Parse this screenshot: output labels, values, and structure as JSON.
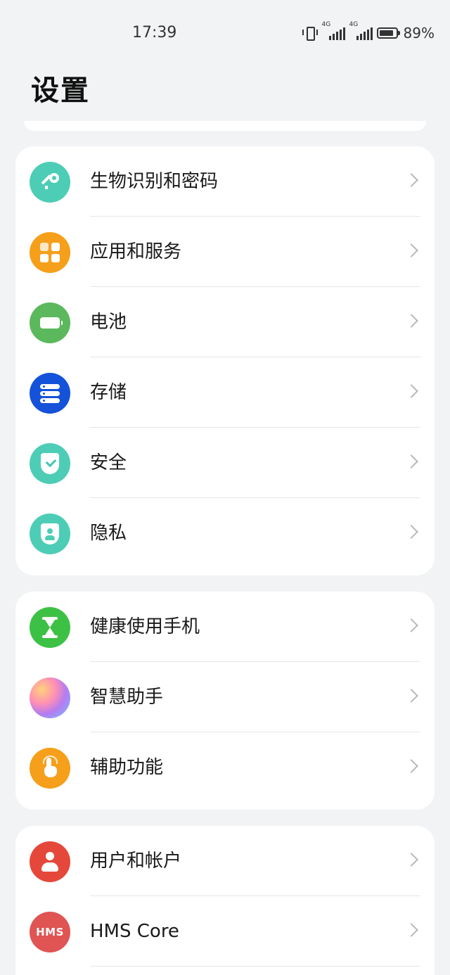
{
  "status_bar": {
    "time": "17:39",
    "network_1": "4G",
    "network_2": "4G",
    "battery_percent": "89%",
    "battery_level": 0.89
  },
  "header": {
    "title": "设置"
  },
  "groups": [
    {
      "items": [
        {
          "label": "生物识别和密码",
          "icon": "key-icon",
          "color": "#4dcdb5"
        },
        {
          "label": "应用和服务",
          "icon": "apps-grid-icon",
          "color": "#f59f1a"
        },
        {
          "label": "电池",
          "icon": "battery-icon",
          "color": "#5cb85c"
        },
        {
          "label": "存储",
          "icon": "storage-icon",
          "color": "#1452d9"
        },
        {
          "label": "安全",
          "icon": "shield-check-icon",
          "color": "#4dcdb5"
        },
        {
          "label": "隐私",
          "icon": "privacy-shield-icon",
          "color": "#4dcdb5"
        }
      ]
    },
    {
      "items": [
        {
          "label": "健康使用手机",
          "icon": "hourglass-icon",
          "color": "#3dc144"
        },
        {
          "label": "智慧助手",
          "icon": "celia-assistant-icon",
          "color": "#b57cf0"
        },
        {
          "label": "辅助功能",
          "icon": "accessibility-hand-icon",
          "color": "#f59f1a"
        }
      ]
    },
    {
      "items": [
        {
          "label": "用户和帐户",
          "icon": "user-icon",
          "color": "#e5483a"
        },
        {
          "label": "HMS Core",
          "icon": "hms-core-icon",
          "color": "#e05454",
          "icon_text": "HMS"
        }
      ]
    }
  ]
}
